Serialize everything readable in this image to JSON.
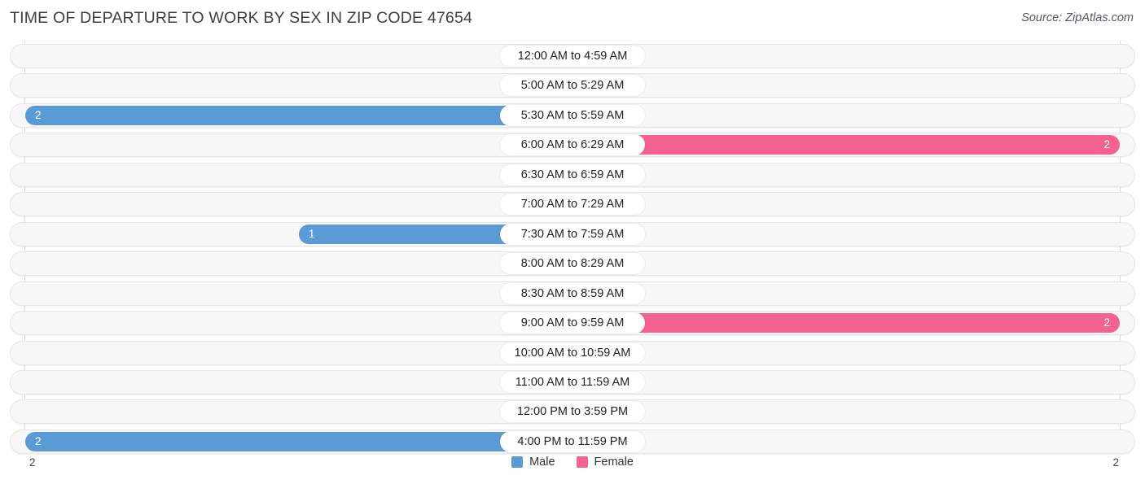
{
  "header": {
    "title": "TIME OF DEPARTURE TO WORK BY SEX IN ZIP CODE 47654",
    "source": "Source: ZipAtlas.com"
  },
  "legend": {
    "male_label": "Male",
    "female_label": "Female",
    "male_color": "#5b9bd5",
    "female_color": "#f4628f"
  },
  "axis": {
    "left_tick": "2",
    "right_tick": "2"
  },
  "colors": {
    "male_zero": "#a8c8ec",
    "male_value": "#5b9bd5",
    "female_zero": "#f7acc8",
    "female_value": "#f4628f",
    "track": "#f7f7f7",
    "gridline": "#d9dade"
  },
  "chart_data": {
    "type": "bar",
    "title": "TIME OF DEPARTURE TO WORK BY SEX IN ZIP CODE 47654",
    "subtitle": "",
    "orientation": "horizontal-diverging",
    "xlabel": "",
    "ylabel": "",
    "xlim": [
      2,
      2
    ],
    "grid": true,
    "legend_position": "bottom-center",
    "categories": [
      "12:00 AM to 4:59 AM",
      "5:00 AM to 5:29 AM",
      "5:30 AM to 5:59 AM",
      "6:00 AM to 6:29 AM",
      "6:30 AM to 6:59 AM",
      "7:00 AM to 7:29 AM",
      "7:30 AM to 7:59 AM",
      "8:00 AM to 8:29 AM",
      "8:30 AM to 8:59 AM",
      "9:00 AM to 9:59 AM",
      "10:00 AM to 10:59 AM",
      "11:00 AM to 11:59 AM",
      "12:00 PM to 3:59 PM",
      "4:00 PM to 11:59 PM"
    ],
    "series": [
      {
        "name": "Male",
        "values": [
          0,
          0,
          2,
          0,
          0,
          0,
          1,
          0,
          0,
          0,
          0,
          0,
          0,
          2
        ]
      },
      {
        "name": "Female",
        "values": [
          0,
          0,
          0,
          2,
          0,
          0,
          0,
          0,
          0,
          2,
          0,
          0,
          0,
          0
        ]
      }
    ]
  },
  "rows": [
    {
      "label": "12:00 AM to 4:59 AM",
      "male": "0",
      "female": "0"
    },
    {
      "label": "5:00 AM to 5:29 AM",
      "male": "0",
      "female": "0"
    },
    {
      "label": "5:30 AM to 5:59 AM",
      "male": "2",
      "female": "0"
    },
    {
      "label": "6:00 AM to 6:29 AM",
      "male": "0",
      "female": "2"
    },
    {
      "label": "6:30 AM to 6:59 AM",
      "male": "0",
      "female": "0"
    },
    {
      "label": "7:00 AM to 7:29 AM",
      "male": "0",
      "female": "0"
    },
    {
      "label": "7:30 AM to 7:59 AM",
      "male": "1",
      "female": "0"
    },
    {
      "label": "8:00 AM to 8:29 AM",
      "male": "0",
      "female": "0"
    },
    {
      "label": "8:30 AM to 8:59 AM",
      "male": "0",
      "female": "0"
    },
    {
      "label": "9:00 AM to 9:59 AM",
      "male": "0",
      "female": "2"
    },
    {
      "label": "10:00 AM to 10:59 AM",
      "male": "0",
      "female": "0"
    },
    {
      "label": "11:00 AM to 11:59 AM",
      "male": "0",
      "female": "0"
    },
    {
      "label": "12:00 PM to 3:59 PM",
      "male": "0",
      "female": "0"
    },
    {
      "label": "4:00 PM to 11:59 PM",
      "male": "2",
      "female": "0"
    }
  ]
}
